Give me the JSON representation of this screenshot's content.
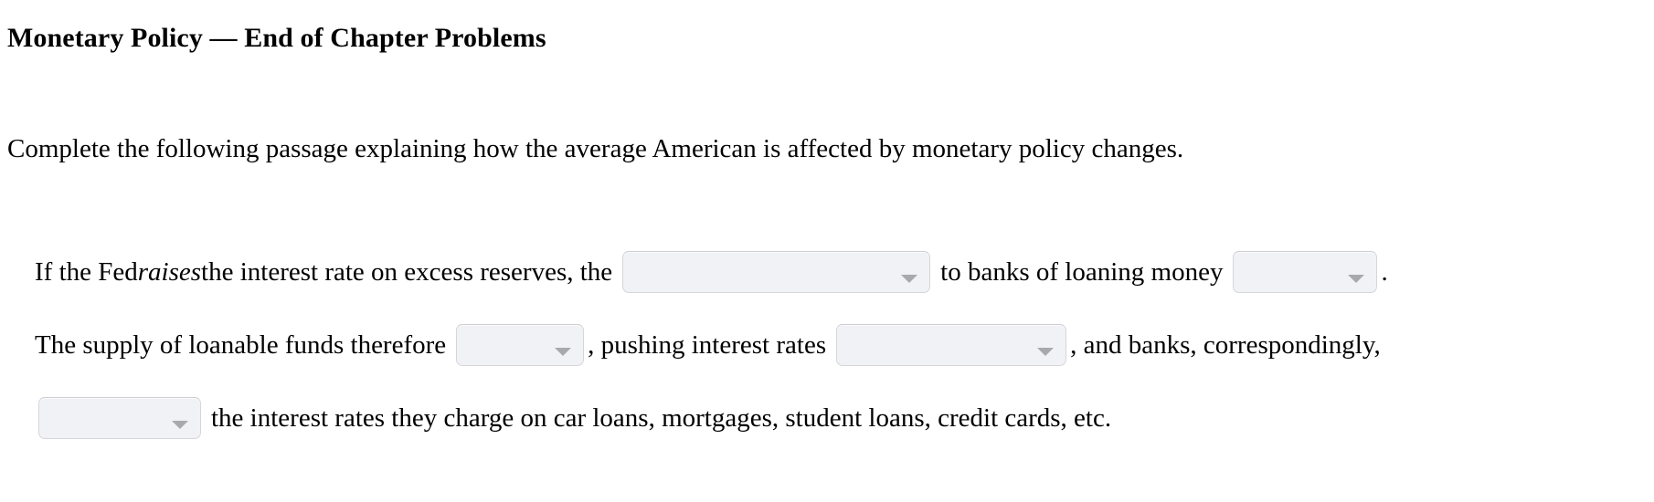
{
  "page": {
    "title": "Monetary Policy — End of Chapter Problems",
    "instruction": "Complete the following passage explaining how the average American is affected by monetary policy changes."
  },
  "colors": {
    "page_background": "#ffffff",
    "text": "#000000",
    "select_fill": "#f1f2f6",
    "select_border": "#d6d6da",
    "select_caret": "#a9a9ad"
  },
  "passage": {
    "line1": {
      "text_a": "If the Fed ",
      "emphasis": "raises",
      "text_b": " the interest rate on excess reserves, the",
      "text_c": "to banks of loaning money",
      "text_d": "."
    },
    "line2": {
      "text_a": "The supply of loanable funds therefore",
      "text_b": ", pushing interest rates",
      "text_c": ", and banks, correspondingly,"
    },
    "line3": {
      "text_a": "the interest rates they charge on car loans, mortgages, student loans, credit cards, etc."
    }
  },
  "dropdowns": [
    {
      "id": "cost-benefit-select",
      "value": "",
      "placeholder": "",
      "caret": "chevron-down-icon"
    },
    {
      "id": "rises-falls-select",
      "value": "",
      "placeholder": "",
      "caret": "chevron-down-icon"
    },
    {
      "id": "supply-change-select",
      "value": "",
      "placeholder": "",
      "caret": "chevron-down-icon"
    },
    {
      "id": "interest-direction-select",
      "value": "",
      "placeholder": "",
      "caret": "chevron-down-icon"
    },
    {
      "id": "bank-rate-action-select",
      "value": "",
      "placeholder": "",
      "caret": "chevron-down-icon"
    }
  ]
}
